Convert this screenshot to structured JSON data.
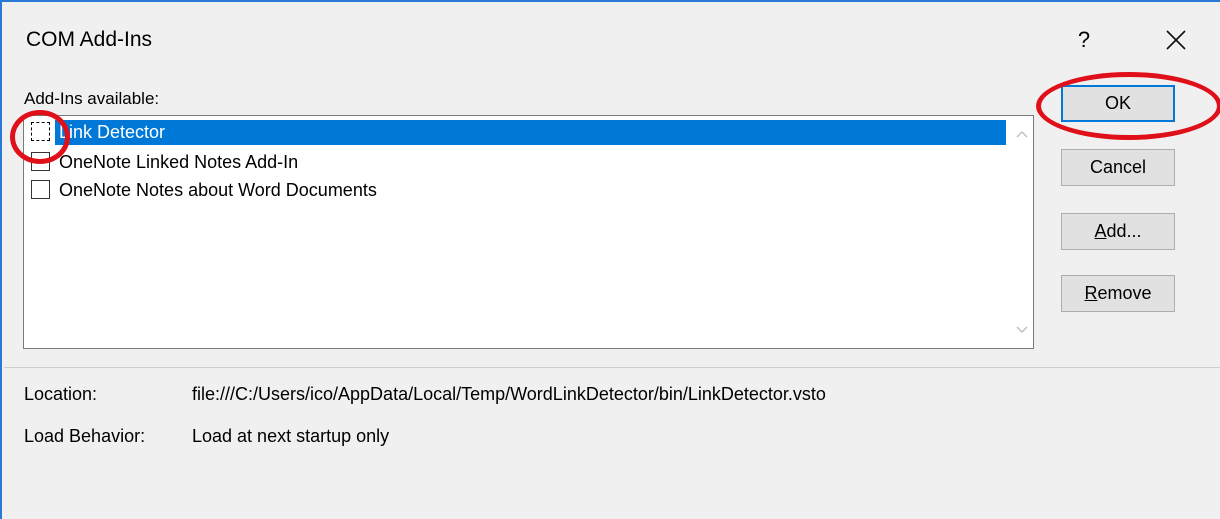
{
  "window": {
    "title": "COM Add-Ins",
    "help_glyph": "?",
    "close_icon": "close-icon"
  },
  "addins": {
    "group_label": "Add-Ins available:",
    "items": [
      {
        "label": "Link Detector",
        "checked": false,
        "selected": true
      },
      {
        "label": "OneNote Linked Notes Add-In",
        "checked": false,
        "selected": false
      },
      {
        "label": "OneNote Notes about Word Documents",
        "checked": false,
        "selected": false
      }
    ]
  },
  "buttons": {
    "ok": "OK",
    "cancel": "Cancel",
    "add_prefix": "A",
    "add_rest": "dd...",
    "remove_prefix": "R",
    "remove_rest": "emove"
  },
  "details": {
    "location_label": "Location:",
    "location_value": "file:///C:/Users/ico/AppData/Local/Temp/WordLinkDetector/bin/LinkDetector.vsto",
    "load_behavior_label": "Load Behavior:",
    "load_behavior_value": "Load at next startup only"
  },
  "colors": {
    "accent": "#0078d7",
    "annotation": "#e0101b",
    "window_border": "#2b79d6"
  }
}
